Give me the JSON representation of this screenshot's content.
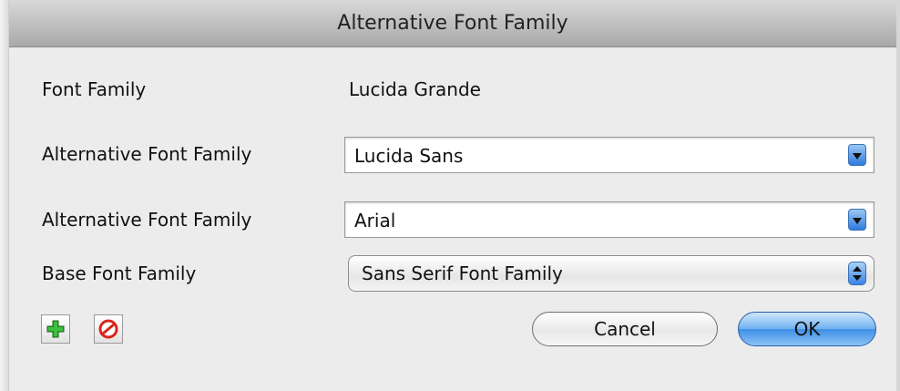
{
  "window": {
    "title": "Alternative Font Family"
  },
  "form": {
    "font_family": {
      "label": "Font Family",
      "value": "Lucida Grande"
    },
    "alt_family_1": {
      "label": "Alternative Font Family",
      "value": "Lucida Sans"
    },
    "alt_family_2": {
      "label": "Alternative Font Family",
      "value": "Arial"
    },
    "base_family": {
      "label": "Base Font Family",
      "value": "Sans Serif Font Family"
    }
  },
  "toolbar": {
    "add_icon": "plus-icon",
    "remove_icon": "remove-icon"
  },
  "buttons": {
    "cancel_label": "Cancel",
    "ok_label": "OK"
  },
  "colors": {
    "accent": "#3e8fe6",
    "add_green": "#2e9f2e",
    "remove_red": "#d9261c"
  }
}
